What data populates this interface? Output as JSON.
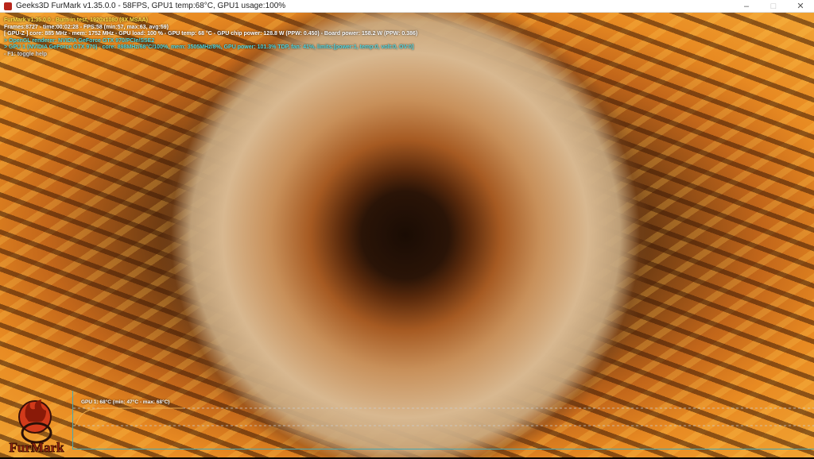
{
  "window": {
    "title": "Geeks3D FurMark v1.35.0.0 - 58FPS, GPU1 temp:68°C, GPU1 usage:100%",
    "minimize": "–",
    "maximize": "□",
    "close": "✕"
  },
  "hud": {
    "line1": "FurMark v1.35.0.0 - Burn-in test, 1920x1080 (8X MSAA)",
    "line2": "Frames:8727 - time:00:02:28 - FPS:58 (min:57, max:63, avg:59)",
    "line3": "[ GPU-Z ] core: 885 MHz - mem: 1752 MHz - GPU load: 100 % - GPU temp: 68 °C - GPU chip power: 128.8 W (PPW: 0.450) - Board power: 158.2 W (PPW: 0.386)",
    "line4": "> OpenGL renderer: NVIDIA GeForce GTX 970/PCIe/SSE2",
    "line5": "> GPU 1 (NVIDIA GeForce GTX 970) - core: 898MHz/68°C/100%, mem: 3505MHz/8%, GPU power: 101.3% TDP, fan: 41%, limits:[power:1, temp:0, volt:0, OV:0]",
    "line6": "- F1: toggle help"
  },
  "graph": {
    "label": "GPU 1: 68°C (min: 47°C - max: 68°C)",
    "current": 68,
    "min": 47,
    "max": 68,
    "color": "#f0b050"
  },
  "logo": {
    "text": "FurMark"
  }
}
